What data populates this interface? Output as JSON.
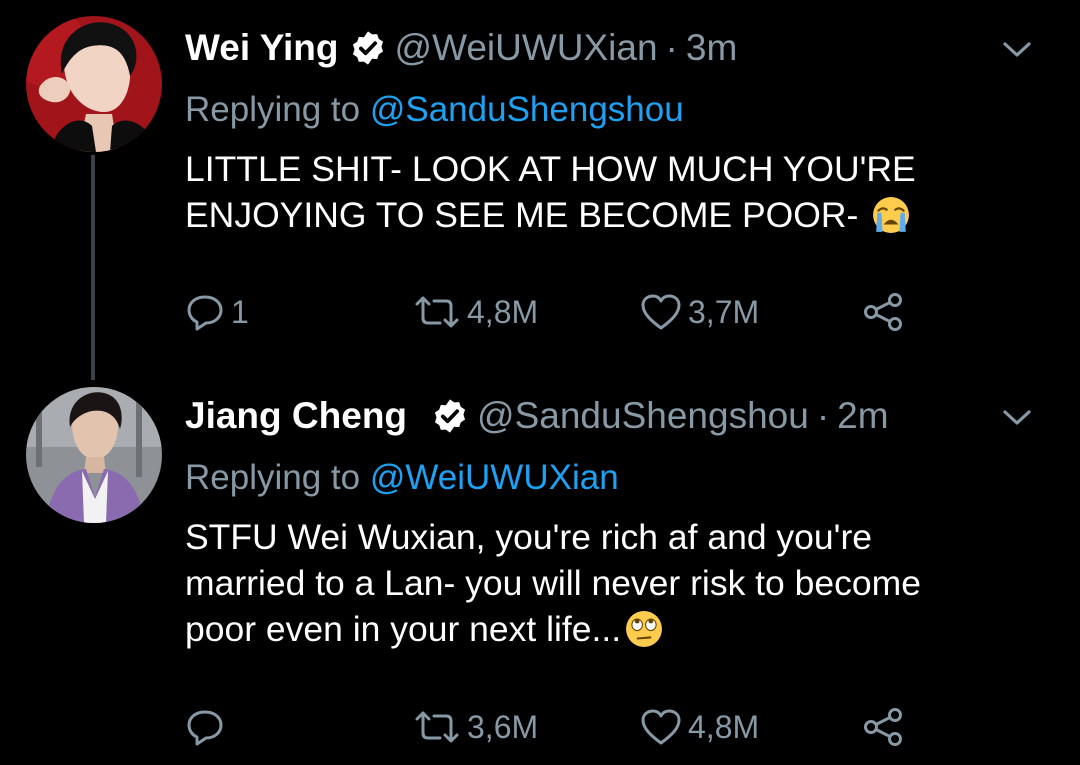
{
  "colors": {
    "background": "#000000",
    "text_primary": "#ffffff",
    "text_secondary": "#8899a6",
    "link": "#1da1f2",
    "thread_line": "#3d4148"
  },
  "tweets": [
    {
      "author_name": "Wei Ying",
      "handle": "@WeiUWUXian",
      "separator": "·",
      "time": "3m",
      "verified_icon": "verified-badge-icon",
      "replying_prefix": "Replying to",
      "replying_to": "@SanduShengshou",
      "text": "LITTLE SHIT- LOOK AT HOW MUCH YOU'RE\nENJOYING TO SEE ME BECOME POOR- ",
      "emoji": "loudly-crying-face-emoji",
      "reply_count": "1",
      "retweet_count": "4,8M",
      "like_count": "3,7M"
    },
    {
      "author_name": "Jiang Cheng",
      "handle": "@SanduShengshou",
      "separator": "·",
      "time": "2m",
      "verified_icon": "verified-badge-icon",
      "replying_prefix": "Replying to",
      "replying_to": "@WeiUWUXian",
      "text": "STFU Wei Wuxian, you're rich af and you're\nmarried to a Lan- you will never risk to become\npoor even in your next life...",
      "emoji": "face-with-rolling-eyes-emoji",
      "reply_count": "",
      "retweet_count": "3,6M",
      "like_count": "4,8M"
    }
  ]
}
